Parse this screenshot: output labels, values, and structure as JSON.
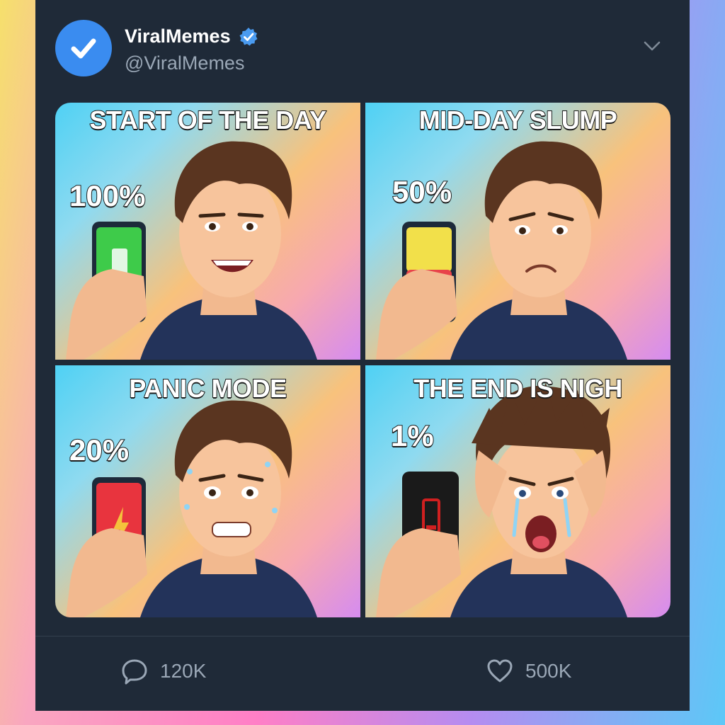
{
  "post": {
    "display_name": "ViralMemes",
    "handle": "@ViralMemes",
    "verified": true
  },
  "panels": [
    {
      "caption": "START OF THE DAY",
      "battery": "100%",
      "battery_color": "#3ecb4a",
      "mood": "happy"
    },
    {
      "caption": "MID-DAY SLUMP",
      "battery": "50%",
      "battery_color": "#f2e04a",
      "mood": "sad"
    },
    {
      "caption": "PANIC MODE",
      "battery": "20%",
      "battery_color": "#e8343e",
      "mood": "panic"
    },
    {
      "caption": "THE END IS NIGH",
      "battery": "1%",
      "battery_color": "#1a1a1a",
      "mood": "despair"
    }
  ],
  "actions": {
    "replies": "120K",
    "likes": "500K"
  },
  "colors": {
    "card_bg": "#1f2a38",
    "accent_blue": "#3a8cf0",
    "muted_text": "#9aa7b6"
  }
}
